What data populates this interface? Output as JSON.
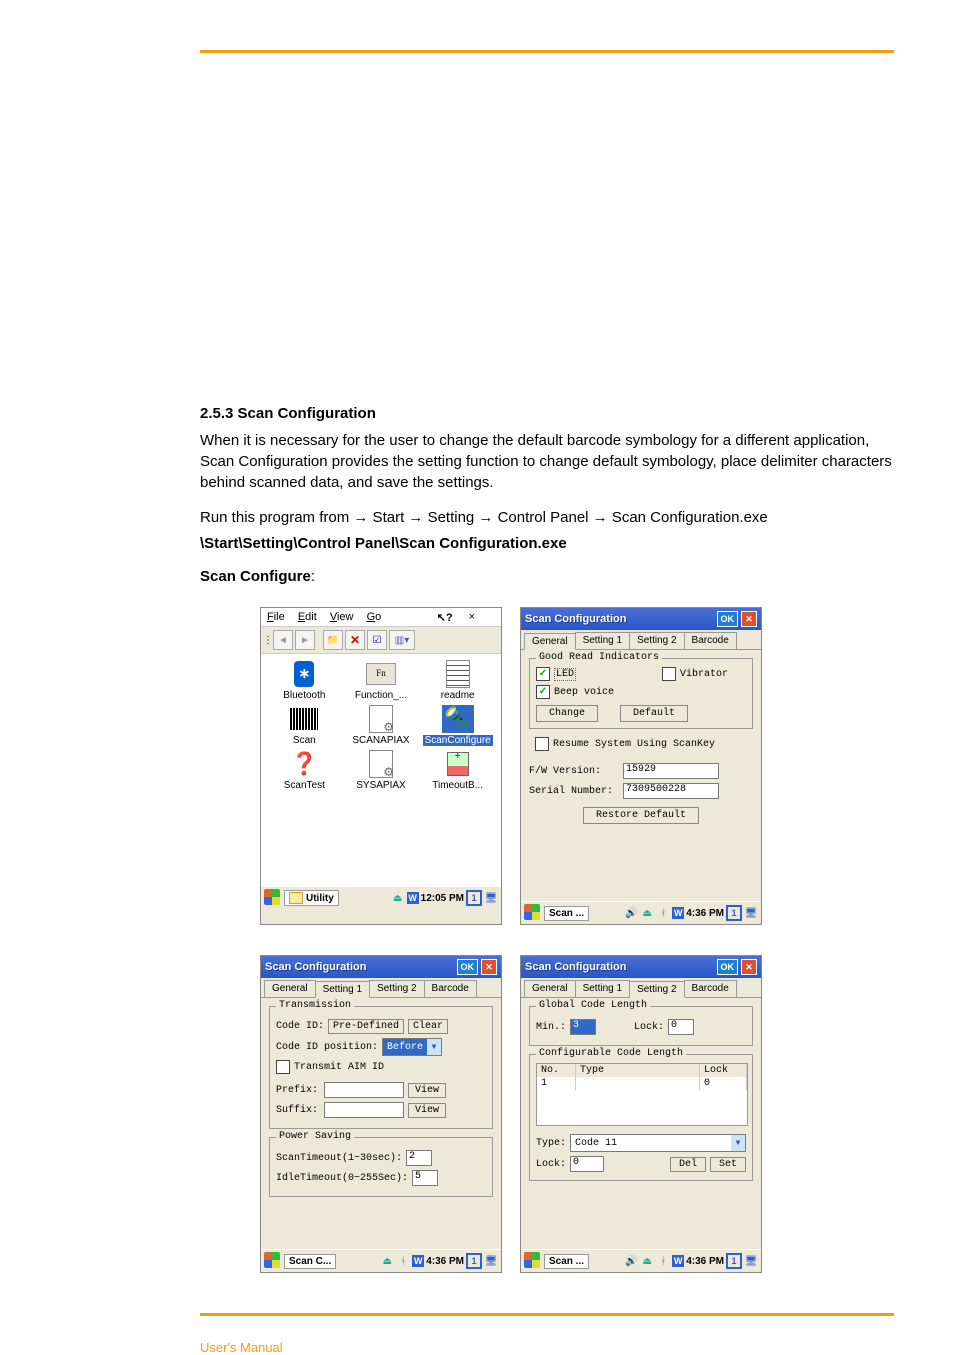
{
  "footer": "User's Manual",
  "section": {
    "number": "2.5.3",
    "title": "Scan Configuration",
    "intro": "When it is necessary for the user to change the default barcode symbology for a different application, Scan Configuration provides the setting function to change default symbology, place delimiter characters behind scanned data, and save the settings.",
    "run_prefix": "Run this program from ",
    "path_bold": "\\Start\\Setting\\Control Panel\\Scan Configuration.exe",
    "caption_left": "Scan Configure",
    "caption_right": ":"
  },
  "explorer": {
    "menu": {
      "file": "File",
      "edit": "Edit",
      "view": "View",
      "go": "Go"
    },
    "close_x": "×",
    "help_cursor": "?",
    "items": [
      "Bluetooth",
      "Function_...",
      "readme",
      "Scan",
      "SCANAPIAX",
      "ScanConfigure",
      "ScanTest",
      "SYSAPIAX",
      "TimeoutB..."
    ],
    "taskbar": {
      "button": "Utility",
      "time": "12:05 PM"
    }
  },
  "scan_general": {
    "title": "Scan Configuration",
    "tabs": [
      "General",
      "Setting 1",
      "Setting 2",
      "Barcode"
    ],
    "group_indicators": "Good Read Indicators",
    "chk_led": "LED",
    "chk_vibrator": "Vibrator",
    "chk_beep": "Beep voice",
    "btn_change": "Change",
    "btn_default": "Default",
    "chk_resume": "Resume System Using ScanKey",
    "fw_label": "F/W Version:",
    "fw_value": "15929",
    "sn_label": "Serial Number:",
    "sn_value": "7309500228",
    "btn_restore": "Restore Default",
    "taskbar": {
      "button": "Scan ...",
      "time": "4:36 PM"
    }
  },
  "scan_setting1": {
    "title": "Scan Configuration",
    "tabs": [
      "General",
      "Setting 1",
      "Setting 2",
      "Barcode"
    ],
    "group_trans": "Transmission",
    "codeid_label": "Code ID:",
    "btn_predefined": "Pre-Defined",
    "btn_clear": "Clear",
    "codeid_pos_label": "Code ID position:",
    "codeid_pos_value": "Before",
    "chk_aim": "Transmit AIM ID",
    "prefix_label": "Prefix:",
    "suffix_label": "Suffix:",
    "btn_view": "View",
    "group_power": "Power Saving",
    "scan_to_label": "ScanTimeout(1~30sec):",
    "scan_to_value": "2",
    "idle_to_label": "IdleTimeout(0~255Sec):",
    "idle_to_value": "5",
    "taskbar": {
      "button": "Scan C...",
      "time": "4:36 PM"
    }
  },
  "scan_setting2": {
    "title": "Scan Configuration",
    "tabs": [
      "General",
      "Setting 1",
      "Setting 2",
      "Barcode"
    ],
    "group_global": "Global Code Length",
    "min_label": "Min.:",
    "min_value": "3",
    "lock_label": "Lock:",
    "lock_value": "0",
    "group_conf": "Configurable Code Length",
    "th_no": "No.",
    "th_type": "Type",
    "th_lock": "Lock",
    "row_no": "1",
    "row_lock": "0",
    "type_label": "Type:",
    "type_value": "Code 11",
    "lock2_label": "Lock:",
    "lock2_value": "0",
    "btn_del": "Del",
    "btn_set": "Set",
    "taskbar": {
      "button": "Scan ...",
      "time": "4:36 PM"
    }
  }
}
